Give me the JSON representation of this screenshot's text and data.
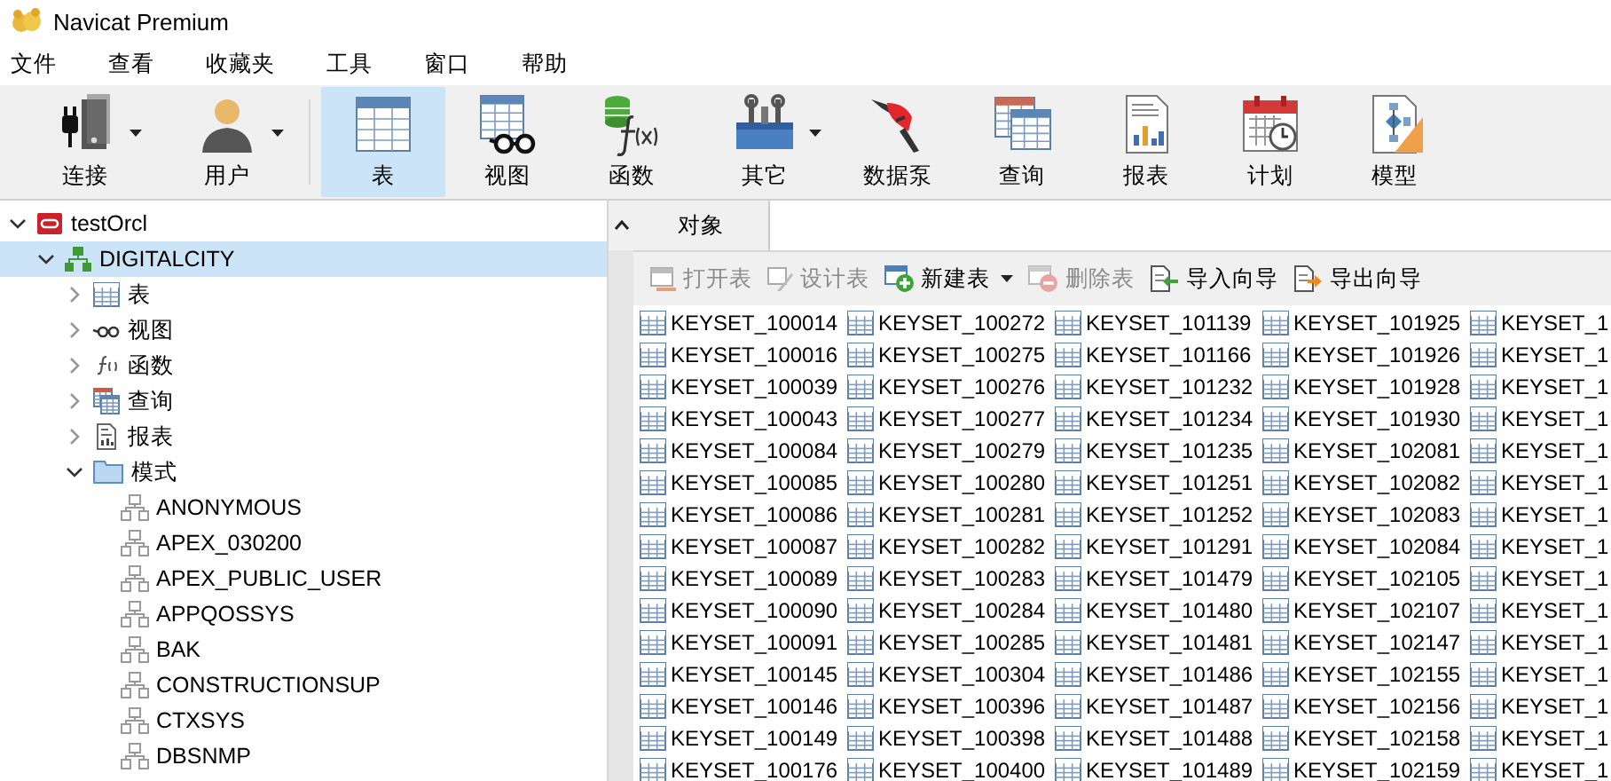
{
  "window": {
    "title": "Navicat Premium"
  },
  "menu": [
    "文件",
    "查看",
    "收藏夹",
    "工具",
    "窗口",
    "帮助"
  ],
  "toolbar": [
    {
      "kind": "connect",
      "label": "连接",
      "dropdown": true,
      "selected": false
    },
    {
      "kind": "user",
      "label": "用户",
      "dropdown": true,
      "selected": false
    },
    {
      "kind": "table",
      "label": "表",
      "dropdown": false,
      "selected": true
    },
    {
      "kind": "view",
      "label": "视图",
      "dropdown": false,
      "selected": false
    },
    {
      "kind": "function",
      "label": "函数",
      "dropdown": false,
      "selected": false
    },
    {
      "kind": "other",
      "label": "其它",
      "dropdown": true,
      "selected": false
    },
    {
      "kind": "datapump",
      "label": "数据泵",
      "dropdown": false,
      "selected": false
    },
    {
      "kind": "query",
      "label": "查询",
      "dropdown": false,
      "selected": false
    },
    {
      "kind": "report",
      "label": "报表",
      "dropdown": false,
      "selected": false
    },
    {
      "kind": "schedule",
      "label": "计划",
      "dropdown": false,
      "selected": false
    },
    {
      "kind": "model",
      "label": "模型",
      "dropdown": false,
      "selected": false
    }
  ],
  "tree": [
    {
      "kind": "connection",
      "label": "testOrcl",
      "expanded": true,
      "selected": false,
      "children": [
        {
          "kind": "database",
          "label": "DIGITALCITY",
          "expanded": true,
          "selected": true,
          "children": [
            {
              "kind": "tables",
              "label": "表",
              "expanded": false,
              "selected": false
            },
            {
              "kind": "views",
              "label": "视图",
              "expanded": false,
              "selected": false
            },
            {
              "kind": "functions",
              "label": "函数",
              "expanded": false,
              "selected": false
            },
            {
              "kind": "queries",
              "label": "查询",
              "expanded": false,
              "selected": false
            },
            {
              "kind": "reports",
              "label": "报表",
              "expanded": false,
              "selected": false
            },
            {
              "kind": "schemas",
              "label": "模式",
              "expanded": true,
              "selected": false,
              "children": [
                {
                  "kind": "schema",
                  "label": "ANONYMOUS",
                  "selected": false
                },
                {
                  "kind": "schema",
                  "label": "APEX_030200",
                  "selected": false
                },
                {
                  "kind": "schema",
                  "label": "APEX_PUBLIC_USER",
                  "selected": false
                },
                {
                  "kind": "schema",
                  "label": "APPQOSSYS",
                  "selected": false
                },
                {
                  "kind": "schema",
                  "label": "BAK",
                  "selected": false
                },
                {
                  "kind": "schema",
                  "label": "CONSTRUCTIONSUP",
                  "selected": false
                },
                {
                  "kind": "schema",
                  "label": "CTXSYS",
                  "selected": false
                },
                {
                  "kind": "schema",
                  "label": "DBSNMP",
                  "selected": false
                }
              ]
            }
          ]
        }
      ]
    }
  ],
  "tabs": [
    {
      "label": "对象",
      "selected": true
    }
  ],
  "object_toolbar": [
    {
      "kind": "open",
      "label": "打开表",
      "disabled": true,
      "dropdown": false
    },
    {
      "kind": "design",
      "label": "设计表",
      "disabled": true,
      "dropdown": false
    },
    {
      "kind": "new",
      "label": "新建表",
      "disabled": false,
      "dropdown": true
    },
    {
      "kind": "delete",
      "label": "删除表",
      "disabled": true,
      "dropdown": false
    },
    {
      "kind": "import",
      "label": "导入向导",
      "disabled": false,
      "dropdown": false
    },
    {
      "kind": "export",
      "label": "导出向导",
      "disabled": false,
      "dropdown": false
    }
  ],
  "objects": [
    "KEYSET_100014",
    "KEYSET_100016",
    "KEYSET_100039",
    "KEYSET_100043",
    "KEYSET_100084",
    "KEYSET_100085",
    "KEYSET_100086",
    "KEYSET_100087",
    "KEYSET_100089",
    "KEYSET_100090",
    "KEYSET_100091",
    "KEYSET_100145",
    "KEYSET_100146",
    "KEYSET_100149",
    "KEYSET_100176",
    "KEYSET_100272",
    "KEYSET_100275",
    "KEYSET_100276",
    "KEYSET_100277",
    "KEYSET_100279",
    "KEYSET_100280",
    "KEYSET_100281",
    "KEYSET_100282",
    "KEYSET_100283",
    "KEYSET_100284",
    "KEYSET_100285",
    "KEYSET_100304",
    "KEYSET_100396",
    "KEYSET_100398",
    "KEYSET_100400",
    "KEYSET_101139",
    "KEYSET_101166",
    "KEYSET_101232",
    "KEYSET_101234",
    "KEYSET_101235",
    "KEYSET_101251",
    "KEYSET_101252",
    "KEYSET_101291",
    "KEYSET_101479",
    "KEYSET_101480",
    "KEYSET_101481",
    "KEYSET_101486",
    "KEYSET_101487",
    "KEYSET_101488",
    "KEYSET_101489",
    "KEYSET_101925",
    "KEYSET_101926",
    "KEYSET_101928",
    "KEYSET_101930",
    "KEYSET_102081",
    "KEYSET_102082",
    "KEYSET_102083",
    "KEYSET_102084",
    "KEYSET_102105",
    "KEYSET_102107",
    "KEYSET_102147",
    "KEYSET_102155",
    "KEYSET_102156",
    "KEYSET_102158",
    "KEYSET_102159",
    "KEYSET_1",
    "KEYSET_1",
    "KEYSET_1",
    "KEYSET_1",
    "KEYSET_1",
    "KEYSET_1",
    "KEYSET_1",
    "KEYSET_1",
    "KEYSET_1",
    "KEYSET_1",
    "KEYSET_1",
    "KEYSET_1",
    "KEYSET_1",
    "KEYSET_1",
    "KEYSET_1"
  ]
}
